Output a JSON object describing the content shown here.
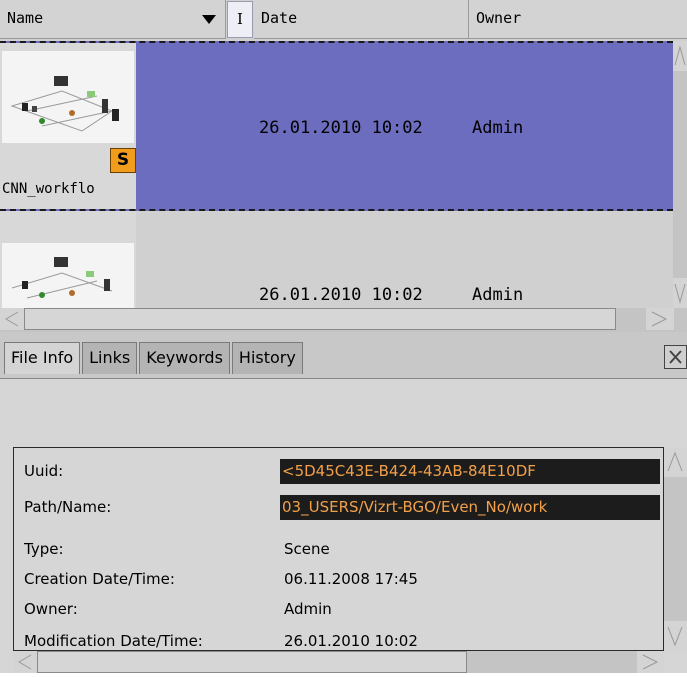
{
  "list": {
    "columns": {
      "name": "Name",
      "i": "I",
      "date": "Date",
      "owner": "Owner"
    },
    "rows": [
      {
        "thumb_label": "CNN_workflo",
        "badge": "S",
        "date": "26.01.2010 10:02",
        "owner": "Admin",
        "selected": true
      },
      {
        "thumb_label": "",
        "date": "26.01.2010 10:02",
        "owner": "Admin",
        "selected": false
      }
    ]
  },
  "tabs": [
    {
      "label": "File Info",
      "active": true
    },
    {
      "label": "Links",
      "active": false
    },
    {
      "label": "Keywords",
      "active": false
    },
    {
      "label": "History",
      "active": false
    }
  ],
  "info": [
    {
      "label": "Uuid:",
      "value": "<5D45C43E-B424-43AB-84E10DF",
      "highlight": true
    },
    {
      "label": "Path/Name:",
      "value": "03_USERS/Vizrt-BGO/Even_No/work",
      "highlight": true
    },
    {
      "label": "Type:",
      "value": "Scene",
      "highlight": false
    },
    {
      "label": "Creation Date/Time:",
      "value": "06.11.2008 17:45",
      "highlight": false
    },
    {
      "label": "Owner:",
      "value": "Admin",
      "highlight": false
    },
    {
      "label": "Modification Date/Time:",
      "value": "26.01.2010 10:02",
      "highlight": false
    }
  ],
  "colors": {
    "selection": "#6d6dbf",
    "badge": "#f29c1e",
    "highlight_text": "#f2a14a"
  }
}
